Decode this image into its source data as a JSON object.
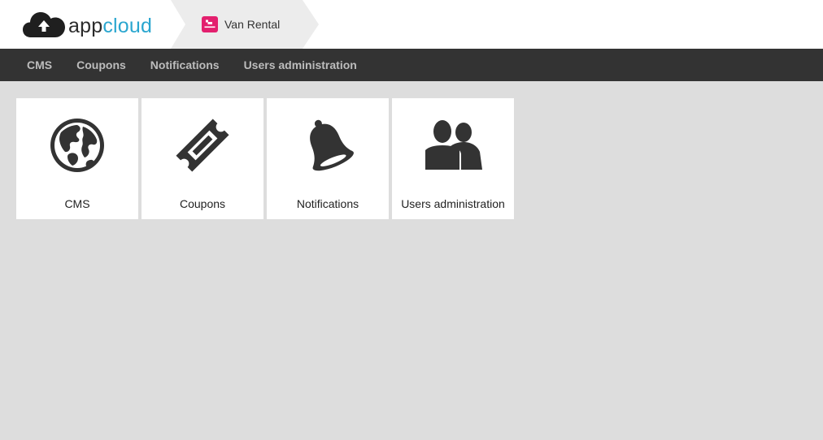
{
  "brand": {
    "name_part1": "app",
    "name_part2": "cloud",
    "accent_color": "#2aa6cf",
    "logo_icon": "cloud-upload-icon"
  },
  "breadcrumb": {
    "app_name": "Van Rental",
    "app_icon": "van-rental-app-icon",
    "app_icon_color": "#e3206e"
  },
  "nav": {
    "items": [
      {
        "label": "CMS"
      },
      {
        "label": "Coupons"
      },
      {
        "label": "Notifications"
      },
      {
        "label": "Users administration"
      }
    ]
  },
  "tiles": [
    {
      "label": "CMS",
      "icon": "globe-icon"
    },
    {
      "label": "Coupons",
      "icon": "ticket-icon"
    },
    {
      "label": "Notifications",
      "icon": "bell-icon"
    },
    {
      "label": "Users administration",
      "icon": "users-icon"
    }
  ]
}
